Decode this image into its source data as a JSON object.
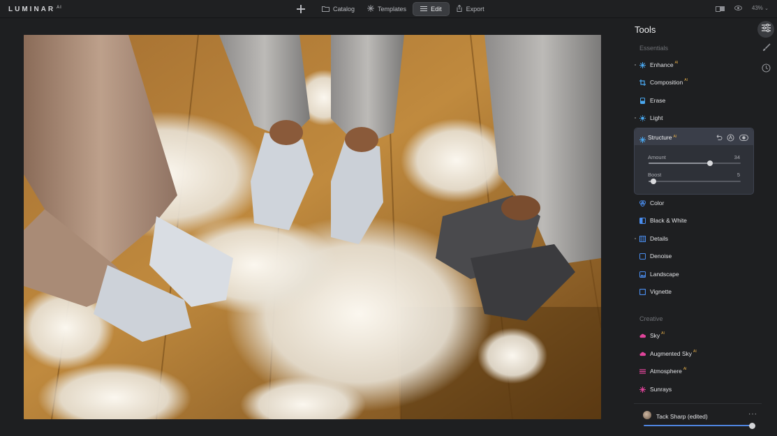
{
  "app": {
    "logo": "LUMINAR",
    "logo_sup": "AI"
  },
  "topnav": {
    "items": [
      {
        "label": "Catalog",
        "icon": "folder-icon"
      },
      {
        "label": "Templates",
        "icon": "sparkle-icon"
      },
      {
        "label": "Edit",
        "icon": "sliders-icon",
        "active": true
      },
      {
        "label": "Export",
        "icon": "export-icon"
      }
    ]
  },
  "topright": {
    "zoom": "43%"
  },
  "panel": {
    "title": "Tools",
    "essentials_label": "Essentials",
    "creative_label": "Creative",
    "ai_badge": "AI",
    "essentials": [
      {
        "label": "Enhance",
        "ai": true,
        "dot": true,
        "icon": "enhance-icon",
        "color": "#4aa8f0"
      },
      {
        "label": "Composition",
        "ai": true,
        "dot": false,
        "icon": "crop-icon",
        "color": "#4aa8f0"
      },
      {
        "label": "Erase",
        "ai": false,
        "dot": false,
        "icon": "eraser-icon",
        "color": "#4aa8f0"
      },
      {
        "label": "Light",
        "ai": false,
        "dot": true,
        "icon": "sun-icon",
        "color": "#4aa8f0"
      },
      {
        "label": "Color",
        "ai": false,
        "dot": false,
        "icon": "color-icon",
        "color": "#4a8ef0"
      },
      {
        "label": "Black & White",
        "ai": false,
        "dot": false,
        "icon": "bw-icon",
        "color": "#4a8ef0"
      },
      {
        "label": "Details",
        "ai": false,
        "dot": true,
        "icon": "details-icon",
        "color": "#4a8ef0"
      },
      {
        "label": "Denoise",
        "ai": false,
        "dot": false,
        "icon": "denoise-icon",
        "color": "#4a8ef0"
      },
      {
        "label": "Landscape",
        "ai": false,
        "dot": false,
        "icon": "landscape-icon",
        "color": "#4a8ef0"
      },
      {
        "label": "Vignette",
        "ai": false,
        "dot": false,
        "icon": "vignette-icon",
        "color": "#4a8ef0"
      }
    ],
    "structure": {
      "label": "Structure",
      "ai": true,
      "amount_label": "Amount",
      "amount_value": "34",
      "amount_fraction": 0.67,
      "boost_label": "Boost",
      "boost_value": "5",
      "boost_fraction": 0.05
    },
    "creative": [
      {
        "label": "Sky",
        "ai": true,
        "icon": "cloud-icon",
        "color": "#e0449a"
      },
      {
        "label": "Augmented Sky",
        "ai": true,
        "icon": "cloud-icon",
        "color": "#e0449a"
      },
      {
        "label": "Atmosphere",
        "ai": true,
        "icon": "atmosphere-icon",
        "color": "#e0449a"
      },
      {
        "label": "Sunrays",
        "ai": false,
        "icon": "sunrays-icon",
        "color": "#e0449a"
      }
    ]
  },
  "preset": {
    "name": "Tack Sharp (edited)",
    "more": "···",
    "strength": 1.0
  }
}
